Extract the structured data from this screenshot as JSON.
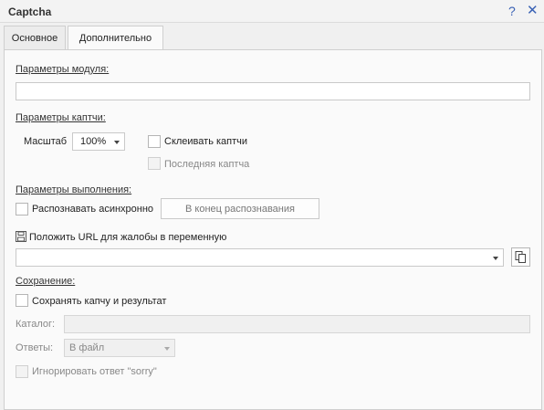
{
  "window": {
    "title": "Captcha",
    "help_icon": "?",
    "close_icon": "✕"
  },
  "tabs": [
    {
      "label": "Основное"
    },
    {
      "label": "Дополнительно"
    }
  ],
  "module_params": {
    "title": "Параметры модуля:",
    "value": ""
  },
  "captcha_params": {
    "title": "Параметры каптчи:",
    "scale_label": "Масштаб",
    "scale_value": "100%",
    "glue_label": "Склеивать каптчи",
    "last_label": "Последняя каптча"
  },
  "execution_params": {
    "title": "Параметры выполнения:",
    "async_label": "Распознавать асинхронно",
    "end_button": "В конец распознавания",
    "url_label": "Положить URL для жалобы в переменную",
    "url_value": ""
  },
  "saving": {
    "title": "Сохранение:",
    "save_label": "Сохранять капчу и результат",
    "catalog_label": "Каталог:",
    "catalog_value": "",
    "answers_label": "Ответы:",
    "answers_value": "В файл",
    "ignore_label": "Игнорировать ответ \"sorry\""
  }
}
